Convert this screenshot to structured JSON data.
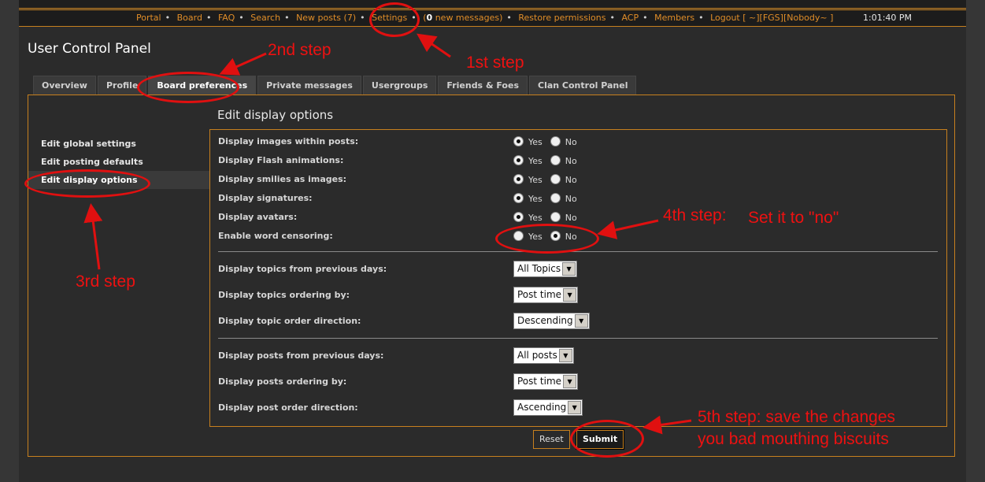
{
  "nav": {
    "links": [
      "Portal",
      "Board",
      "FAQ",
      "Search",
      "New posts (7)",
      "Settings"
    ],
    "messages_prefix": "(",
    "messages_count": "0",
    "messages_suffix": " new messages)",
    "links2": [
      "Restore permissions",
      "ACP",
      "Members",
      "Logout [ ~][FGS][Nobody~ ]"
    ],
    "clock": "1:01:40 PM"
  },
  "page": {
    "title": "User Control Panel"
  },
  "tabs": [
    "Overview",
    "Profile",
    "Board preferences",
    "Private messages",
    "Usergroups",
    "Friends & Foes",
    "Clan Control Panel"
  ],
  "sidebar": {
    "items": [
      "Edit global settings",
      "Edit posting defaults",
      "Edit display options"
    ]
  },
  "section": {
    "title": "Edit display options"
  },
  "options": {
    "yes": "Yes",
    "no": "No",
    "rows": [
      {
        "label": "Display images within posts:",
        "value": "yes"
      },
      {
        "label": "Display Flash animations:",
        "value": "yes"
      },
      {
        "label": "Display smilies as images:",
        "value": "yes"
      },
      {
        "label": "Display signatures:",
        "value": "yes"
      },
      {
        "label": "Display avatars:",
        "value": "yes"
      },
      {
        "label": "Enable word censoring:",
        "value": "no"
      }
    ]
  },
  "topics": [
    {
      "label": "Display topics from previous days:",
      "selected": "All Topics"
    },
    {
      "label": "Display topics ordering by:",
      "selected": "Post time"
    },
    {
      "label": "Display topic order direction:",
      "selected": "Descending"
    }
  ],
  "posts": [
    {
      "label": "Display posts from previous days:",
      "selected": "All posts"
    },
    {
      "label": "Display posts ordering by:",
      "selected": "Post time"
    },
    {
      "label": "Display post order direction:",
      "selected": "Ascending"
    }
  ],
  "buttons": {
    "reset": "Reset",
    "submit": "Submit"
  },
  "annotations": {
    "step1": "1st step",
    "step2": "2nd step",
    "step3": "3rd step",
    "step4": "4th step:",
    "step4_note": "Set it to \"no\"",
    "step5_line1": "5th step: save the changes",
    "step5_line2": "you bad mouthing biscuits"
  },
  "colors": {
    "accent": "#c7801e",
    "link": "#e08d28",
    "annotation": "#ee1111"
  }
}
